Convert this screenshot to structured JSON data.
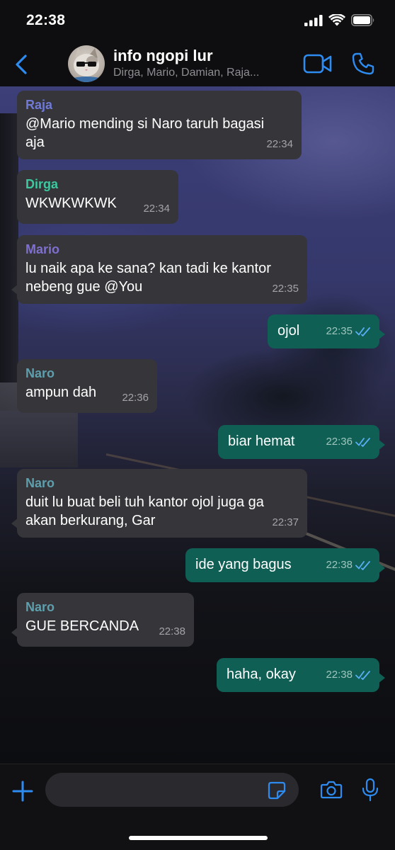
{
  "status_bar": {
    "time": "22:38"
  },
  "header": {
    "title": "info ngopi lur",
    "members": "Dirga, Mario, Damian, Raja..."
  },
  "colors": {
    "accent": "#2e8bf0",
    "incoming_bubble": "#36363a",
    "outgoing_bubble": "#0f5f54",
    "sender_raja": "#6f79d8",
    "sender_dirga": "#3cc9a0",
    "sender_mario": "#7f6fcf",
    "sender_naro": "#5e9fae",
    "read_ticks": "#5aaef5"
  },
  "messages": [
    {
      "direction": "in",
      "sender": "Raja",
      "text": "@Mario mending si Naro taruh bagasi\naja",
      "time": "22:34"
    },
    {
      "direction": "in",
      "sender": "Dirga",
      "text": "WKWKWKWK",
      "time": "22:34"
    },
    {
      "direction": "in",
      "sender": "Mario",
      "text": "lu naik apa ke sana? kan tadi ke kantor\nnebeng gue @You",
      "time": "22:35"
    },
    {
      "direction": "out",
      "text": "ojol",
      "time": "22:35",
      "status": "read"
    },
    {
      "direction": "in",
      "sender": "Naro",
      "text": "ampun dah",
      "time": "22:36"
    },
    {
      "direction": "out",
      "text": "biar hemat",
      "time": "22:36",
      "status": "read"
    },
    {
      "direction": "in",
      "sender": "Naro",
      "text": "duit lu buat beli tuh kantor ojol juga ga\nakan berkurang, Gar",
      "time": "22:37"
    },
    {
      "direction": "out",
      "text": "ide yang bagus",
      "time": "22:38",
      "status": "read"
    },
    {
      "direction": "in",
      "sender": "Naro",
      "text": "GUE BERCANDA",
      "time": "22:38"
    },
    {
      "direction": "out",
      "text": "haha, okay",
      "time": "22:38",
      "status": "read"
    }
  ],
  "composer": {
    "placeholder": ""
  }
}
